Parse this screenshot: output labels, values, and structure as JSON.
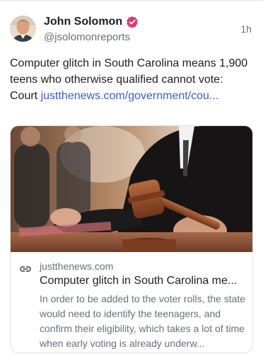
{
  "post": {
    "author_name": "John Solomon",
    "handle": "@jsolomonreports",
    "time": "1h",
    "text_prefix": "Computer glitch in South Carolina means 1,900 teens who otherwise qualified cannot vote: Court ",
    "link_text": "justthenews.com/government/cou...",
    "verified_color": "#e0386d"
  },
  "card": {
    "domain": "justthenews.com",
    "title": "Computer glitch in South Carolina me...",
    "description": "In order to be added to the voter rolls, the state would need to identify the teenagers, and confirm their eligibility, which takes a lot of time when early voting is already underw..."
  }
}
